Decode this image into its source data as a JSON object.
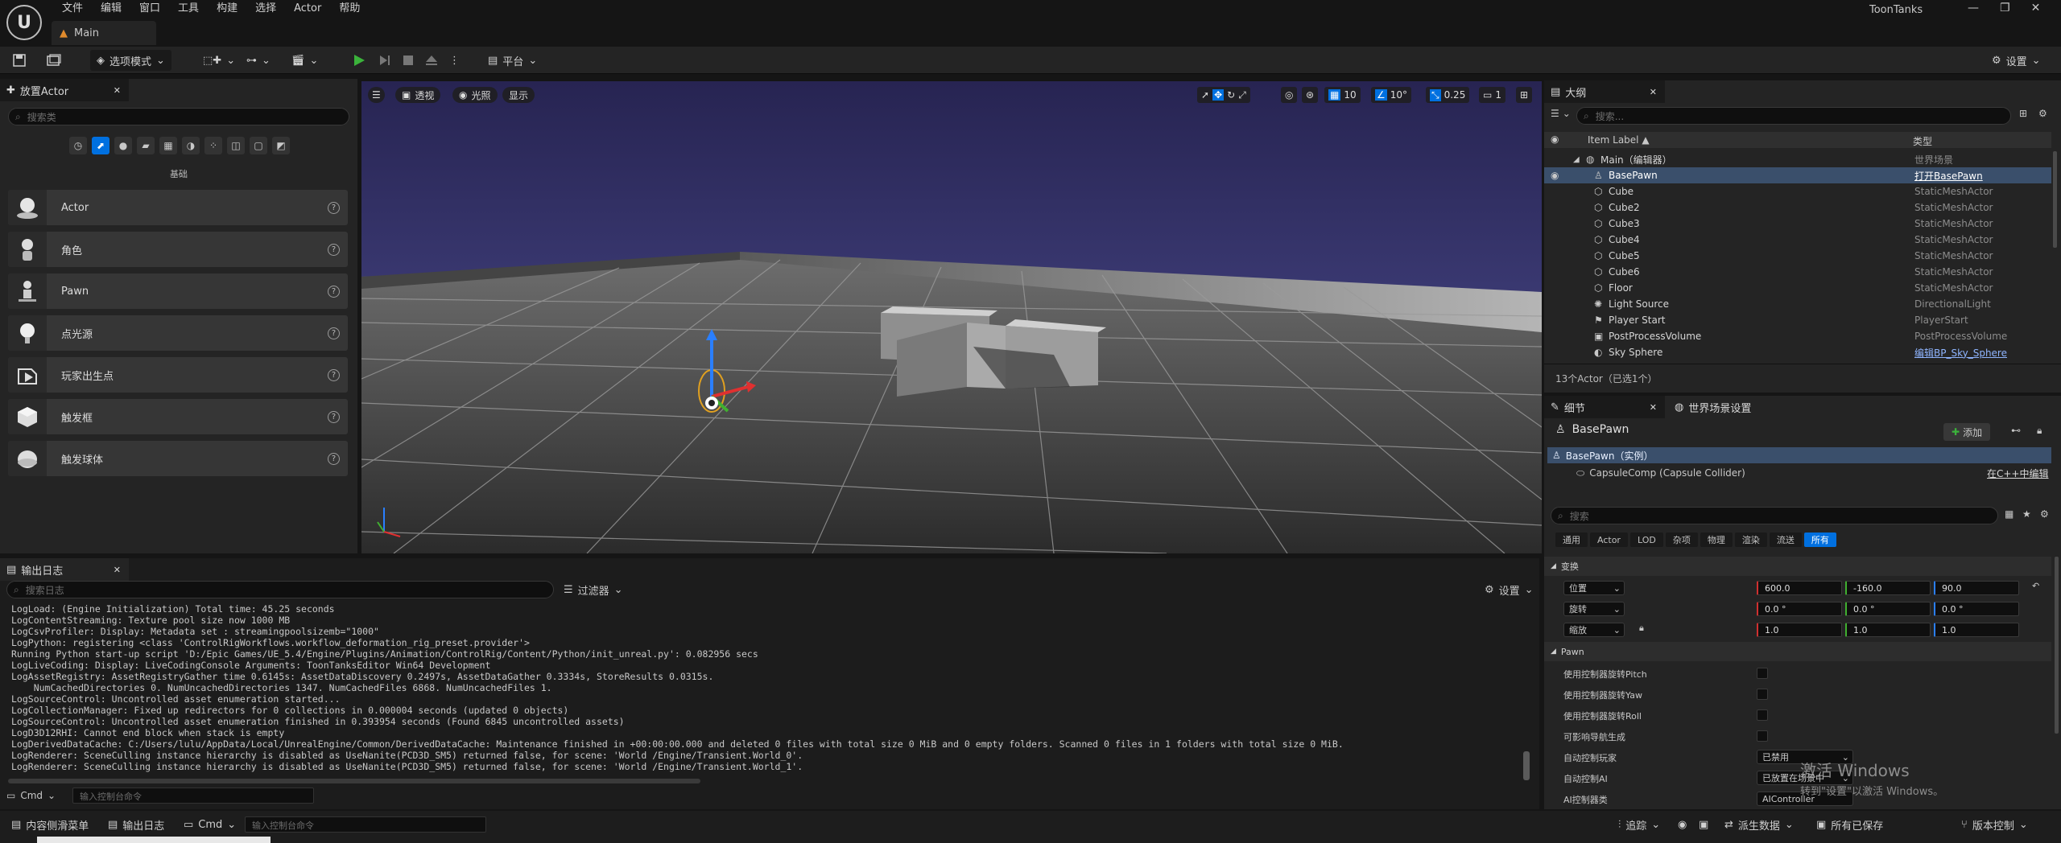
{
  "app": {
    "title": "ToonTanks",
    "map_tab": "Main"
  },
  "menu": [
    "文件",
    "编辑",
    "窗口",
    "工具",
    "构建",
    "选择",
    "Actor",
    "帮助"
  ],
  "toolbar": {
    "mode": "选项模式",
    "platform": "平台",
    "settings": "设置"
  },
  "place_actor": {
    "tab": "放置Actor",
    "search_placeholder": "搜索类",
    "category": "基础",
    "items": [
      "Actor",
      "角色",
      "Pawn",
      "点光源",
      "玩家出生点",
      "触发框",
      "触发球体"
    ]
  },
  "viewport": {
    "perspective": "透视",
    "lit": "光照",
    "show": "显示",
    "grid_snap": "10",
    "rot_snap": "10°",
    "scale_snap": "0.25",
    "camera_speed": "1"
  },
  "output_log": {
    "tab": "输出日志",
    "search_placeholder": "搜索日志",
    "filters": "过滤器",
    "settings": "设置",
    "lines": [
      "LogLoad: (Engine Initialization) Total time: 45.25 seconds",
      "LogContentStreaming: Texture pool size now 1000 MB",
      "LogCsvProfiler: Display: Metadata set : streamingpoolsizemb=\"1000\"",
      "LogPython: registering <class 'ControlRigWorkflows.workflow_deformation_rig_preset.provider'>",
      "Running Python start-up script 'D:/Epic Games/UE_5.4/Engine/Plugins/Animation/ControlRig/Content/Python/init_unreal.py': 0.082956 secs",
      "LogLiveCoding: Display: LiveCodingConsole Arguments: ToonTanksEditor Win64 Development",
      "LogAssetRegistry: AssetRegistryGather time 0.6145s: AssetDataDiscovery 0.2497s, AssetDataGather 0.3334s, StoreResults 0.0315s.",
      "    NumCachedDirectories 0. NumUncachedDirectories 1347. NumCachedFiles 6868. NumUncachedFiles 1.",
      "LogSourceControl: Uncontrolled asset enumeration started...",
      "LogCollectionManager: Fixed up redirectors for 0 collections in 0.000004 seconds (updated 0 objects)",
      "LogSourceControl: Uncontrolled asset enumeration finished in 0.393954 seconds (Found 6845 uncontrolled assets)",
      "LogD3D12RHI: Cannot end block when stack is empty",
      "LogDerivedDataCache: C:/Users/lulu/AppData/Local/UnrealEngine/Common/DerivedDataCache: Maintenance finished in +00:00:00.000 and deleted 0 files with total size 0 MiB and 0 empty folders. Scanned 0 files in 1 folders with total size 0 MiB.",
      "LogRenderer: SceneCulling instance hierarchy is disabled as UseNanite(PCD3D_SM5) returned false, for scene: 'World /Engine/Transient.World_0'.",
      "LogRenderer: SceneCulling instance hierarchy is disabled as UseNanite(PCD3D_SM5) returned false, for scene: 'World /Engine/Transient.World_1'."
    ],
    "cmd_label": "Cmd",
    "cmd_placeholder": "输入控制台命令"
  },
  "outliner": {
    "tab": "大纲",
    "search_placeholder": "搜索...",
    "col_label": "Item Label",
    "col_type": "类型",
    "rows": [
      {
        "label": "Main（编辑器）",
        "type": "世界场景"
      },
      {
        "label": "BasePawn",
        "type": "打开BasePawn"
      },
      {
        "label": "Cube",
        "type": "StaticMeshActor"
      },
      {
        "label": "Cube2",
        "type": "StaticMeshActor"
      },
      {
        "label": "Cube3",
        "type": "StaticMeshActor"
      },
      {
        "label": "Cube4",
        "type": "StaticMeshActor"
      },
      {
        "label": "Cube5",
        "type": "StaticMeshActor"
      },
      {
        "label": "Cube6",
        "type": "StaticMeshActor"
      },
      {
        "label": "Floor",
        "type": "StaticMeshActor"
      },
      {
        "label": "Light Source",
        "type": "DirectionalLight"
      },
      {
        "label": "Player Start",
        "type": "PlayerStart"
      },
      {
        "label": "PostProcessVolume",
        "type": "PostProcessVolume"
      },
      {
        "label": "Sky Sphere",
        "type": "编辑BP_Sky_Sphere"
      }
    ],
    "footer": "13个Actor（已选1个）"
  },
  "details": {
    "tab": "细节",
    "tab2": "世界场景设置",
    "object": "BasePawn",
    "add": "添加",
    "instance": "BasePawn（实例）",
    "component": "CapsuleComp (Capsule Collider)",
    "edit_cpp": "在C++中编辑",
    "search_placeholder": "搜索",
    "filters": [
      "通用",
      "Actor",
      "LOD",
      "杂项",
      "物理",
      "渲染",
      "流送",
      "所有"
    ],
    "transform_header": "变换",
    "location": {
      "label": "位置",
      "x": "600.0",
      "y": "-160.0",
      "z": "90.0"
    },
    "rotation": {
      "label": "旋转",
      "x": "0.0 °",
      "y": "0.0 °",
      "z": "0.0 °"
    },
    "scale": {
      "label": "缩放",
      "x": "1.0",
      "y": "1.0",
      "z": "1.0"
    },
    "pawn_header": "Pawn",
    "pawn_props": [
      "使用控制器旋转Pitch",
      "使用控制器旋转Yaw",
      "使用控制器旋转Roll",
      "可影响导航生成"
    ],
    "auto_possess_player": {
      "label": "自动控制玩家",
      "value": "已禁用"
    },
    "auto_possess_ai": {
      "label": "自动控制AI",
      "value": "已放置在场景中"
    },
    "ai_controller": {
      "label": "AI控制器类",
      "value": "AIController"
    }
  },
  "activation": {
    "title": "激活 Windows",
    "subtitle": "转到\"设置\"以激活 Windows。"
  },
  "statusbar": {
    "content_drawer": "内容侧滑菜单",
    "output_log": "输出日志",
    "cmd": "Cmd",
    "cmd_placeholder": "输入控制台命令",
    "trace": "追踪",
    "derived_data": "派生数据",
    "all_saved": "所有已保存",
    "source_control": "版本控制"
  },
  "colors": {
    "accent": "#0070e0",
    "selection": "#3a4f6b",
    "panel": "#242424",
    "link": "#8fb5ff"
  }
}
